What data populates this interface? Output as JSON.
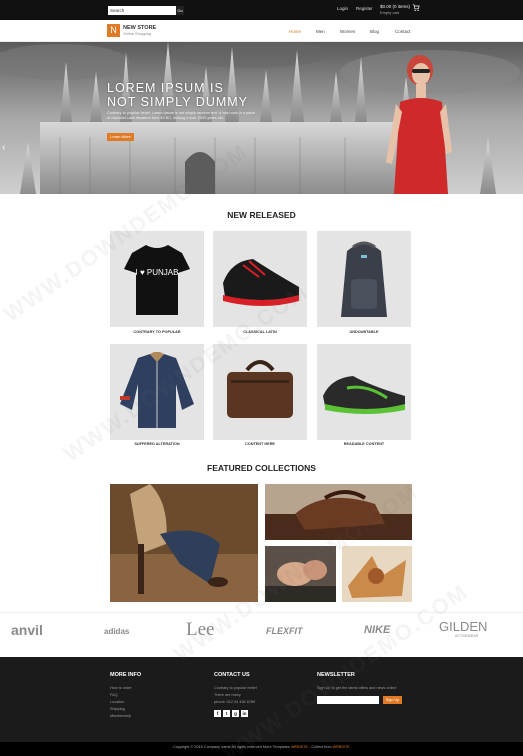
{
  "topbar": {
    "search_placeholder": "Search",
    "search_button": "Go",
    "login": "Login",
    "register": "Register",
    "cart_total": "$0.00 (0 items)",
    "cart_status": "Empty cart"
  },
  "brand": {
    "logo_letter": "N",
    "name": "NEW STORE",
    "tagline": "Online Shopping"
  },
  "nav": {
    "items": [
      "Home",
      "Men",
      "Women",
      "Blog",
      "Contact"
    ],
    "active": "Home"
  },
  "hero": {
    "title_line1": "LOREM IPSUM IS",
    "title_line2": "NOT SIMPLY DUMMY",
    "description": "Contrary to popular belief, Lorem Ipsum is not simply random text. It has roots in a piece of classical Latin literature from 45 BC, making it over 2000 years old.",
    "button": "Learn More",
    "prev_arrow": "‹"
  },
  "new_released": {
    "title": "NEW RELEASED",
    "products": [
      {
        "label": "CONTRARY TO POPULAR",
        "icon": "tshirt-icon"
      },
      {
        "label": "CLASSICAL LATIN",
        "icon": "sneaker-icon"
      },
      {
        "label": "UNDOUBTABLE",
        "icon": "backpack-icon"
      },
      {
        "label": "SUFFERED ALTERATION",
        "icon": "jacket-icon"
      },
      {
        "label": "CONTENT HERE",
        "icon": "bag-icon"
      },
      {
        "label": "READABLE CONTENT",
        "icon": "shoe-icon"
      }
    ],
    "tshirt_text": "I ♥ PUNJAB"
  },
  "featured": {
    "title": "FEATURED COLLECTIONS"
  },
  "brands": [
    "anvil",
    "adidas",
    "Lee",
    "FLEXFIT",
    "NIKE",
    "GILDEN"
  ],
  "brands_sub": {
    "gilden": "ACTIVEWEAR"
  },
  "footer": {
    "more_info": {
      "title": "MORE INFO",
      "items": [
        "How to order",
        "FAQ",
        "Location",
        "Shipping",
        "Membership"
      ]
    },
    "contact": {
      "title": "CONTACT US",
      "lines": [
        "Contrary to popular belief",
        "There are many",
        "phone: 012 34 456 6789"
      ]
    },
    "social": [
      "f",
      "t",
      "g",
      "in"
    ],
    "newsletter": {
      "title": "NEWSLETTER",
      "text": "Sign Up to get the latest offers and news online",
      "button": "Sign Up"
    }
  },
  "copyright": {
    "prefix": "Copyright © 2015 Company name All rights reserved More Templates",
    "link1": "WEBSITE",
    "mid": " - Collect from ",
    "link2": "WEBSITE"
  },
  "watermark": "WWW.DOWNDEMO.COM",
  "colors": {
    "accent": "#e07a25",
    "dark": "#111111",
    "footer": "#1b1b1b"
  }
}
